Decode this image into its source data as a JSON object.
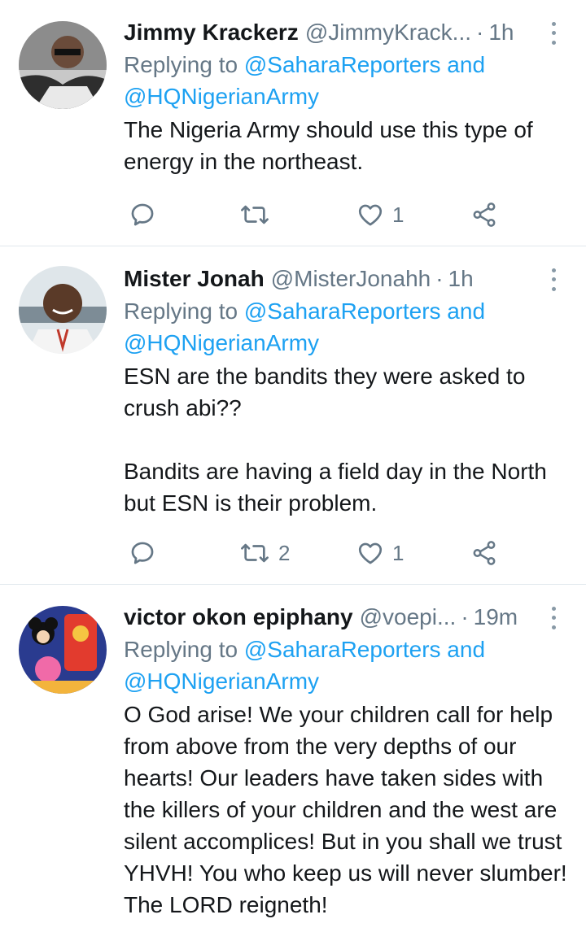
{
  "tweets": [
    {
      "name": "Jimmy Krackerz",
      "handle": "@JimmyKrack...",
      "separator": "·",
      "time": "1h",
      "replying_prefix": "Replying to ",
      "replying_to_1": "@SaharaReporters",
      "replying_and": " and",
      "replying_to_2": "@HQNigerianArmy",
      "text": "The Nigeria Army should use this type of energy in the northeast.",
      "retweets": "",
      "likes": "1",
      "avatar_colors": [
        "#3b3b3b",
        "#d9d9d9"
      ]
    },
    {
      "name": "Mister Jonah",
      "handle": "@MisterJonahh",
      "separator": "·",
      "time": "1h",
      "replying_prefix": "Replying to ",
      "replying_to_1": "@SaharaReporters",
      "replying_and": " and",
      "replying_to_2": "@HQNigerianArmy",
      "text": "ESN are the bandits they were asked to crush abi??\n\nBandits are having a field day in the North but ESN is their problem.",
      "retweets": "2",
      "likes": "1",
      "avatar_colors": [
        "#6b4a36",
        "#f2f2f2"
      ]
    },
    {
      "name": "victor okon epiphany",
      "handle": "@voepi...",
      "separator": "·",
      "time": "19m",
      "replying_prefix": "Replying to ",
      "replying_to_1": "@SaharaReporters",
      "replying_and": " and",
      "replying_to_2": "@HQNigerianArmy",
      "text": "O God arise! We your children call for help from above from the very depths of our hearts! Our leaders have taken sides with the killers of your children and the west are silent accomplices! But in you shall we trust YHVH! You who keep us will never slumber! The LORD reigneth!",
      "retweets": "",
      "likes": "",
      "avatar_colors": [
        "#2a3b8f",
        "#e23b2e"
      ]
    }
  ],
  "colors": {
    "link": "#1da1f2",
    "secondary": "#657786",
    "divider": "#e1e8ed"
  },
  "icons": {
    "reply": "reply-icon",
    "retweet": "retweet-icon",
    "like": "heart-icon",
    "share": "share-icon",
    "more": "more-vertical-icon"
  }
}
